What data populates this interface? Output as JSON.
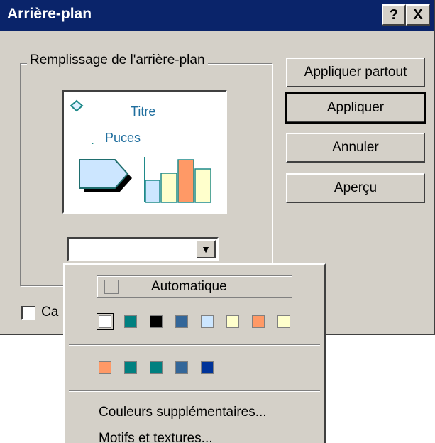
{
  "window": {
    "title": "Arrière-plan",
    "help_label": "?",
    "close_label": "X"
  },
  "group": {
    "label": "Remplissage de l'arrière-plan"
  },
  "preview": {
    "title": "Titre",
    "bullet_marker": ".",
    "bullets": "Puces"
  },
  "combo": {
    "value": "",
    "arrow_icon": "chevron-down-icon"
  },
  "buttons": {
    "apply_all": "Appliquer partout",
    "apply": "Appliquer",
    "cancel": "Annuler",
    "preview": "Aperçu"
  },
  "checkbox": {
    "label": "Ca"
  },
  "dropdown": {
    "automatic": "Automatique",
    "scheme_colors": [
      "#ffffff",
      "#008080",
      "#000000",
      "#336699",
      "#cce6ff",
      "#ffffcc",
      "#ff9966",
      "#ffffcc"
    ],
    "recent_colors": [
      "#ff9966",
      "#008080",
      "#008080",
      "#336699",
      "#003399"
    ],
    "more_colors": "Couleurs supplémentaires...",
    "patterns": "Motifs et textures..."
  }
}
